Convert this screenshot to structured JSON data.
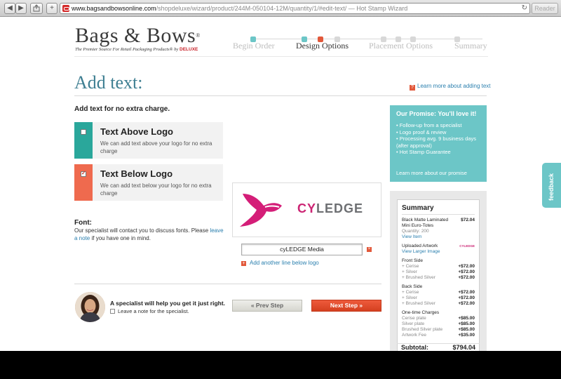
{
  "browser": {
    "url_host": "www.bagsandbowsonline.com",
    "url_path": "/shopdeluxe/wizard/product/244M-050104-12M/quantity/1/#edit-text/",
    "page_title": " — Hot Stamp Wizard",
    "reader_label": "Reader",
    "back_icon": "◀",
    "forward_icon": "▶",
    "add_icon": "+",
    "reload_icon": "↻"
  },
  "header": {
    "logo_name": "Bags & Bows",
    "logo_registered": "®",
    "logo_tagline": "The Premier Source For Retail Packaging Products®",
    "logo_by": "by",
    "logo_deluxe": "DELUXE",
    "steps": [
      {
        "label": "Begin Order"
      },
      {
        "label": "Design Options"
      },
      {
        "label": "Placement Options"
      },
      {
        "label": "Summary"
      }
    ]
  },
  "main": {
    "title": "Add text:",
    "learn_link": "Learn more about adding text",
    "help_glyph": "?",
    "subhead": "Add text for no extra charge.",
    "options": [
      {
        "title": "Text Above Logo",
        "desc": "We can add text above your logo for no extra charge",
        "checked": false,
        "color": "#2aa79b"
      },
      {
        "title": "Text Below Logo",
        "desc": "We can add text below your logo for no extra charge",
        "checked": true,
        "color": "#ef6a4e"
      }
    ],
    "font_title": "Font:",
    "font_text_1": "Our specialist will contact you to discuss fonts. Please",
    "font_link": "leave a note",
    "font_text_2": " if you have one in mind.",
    "preview_brand_1": "CY",
    "preview_brand_2": "LEDGE",
    "text_input_value": "cyLEDGE Media",
    "remove_glyph": "×",
    "add_line_plus": "+",
    "add_line": "Add another line below logo",
    "specialist_title": "A specialist will help you get it just right.",
    "leave_note": "Leave a note for the specialist.",
    "prev_button": "« Prev Step",
    "next_button": "Next Step »"
  },
  "promise": {
    "title": "Our Promise: You'll love it!",
    "items": [
      "Follow-up from a specialist",
      "Logo proof & review",
      "Processing avg. 9 business days (after approval)",
      "Hot Stamp Guarantee"
    ],
    "link": "Learn more about our promise"
  },
  "summary": {
    "title": "Summary",
    "product_name": "Black Matte Laminated Mini Euro-Totes",
    "product_price": "$72.04",
    "quantity": "Quantity: 200",
    "view_item": "View Item",
    "uploaded_artwork": "Uploaded Artwork",
    "view_larger": "View Larger Image",
    "mini_logo": "CYLEDGE",
    "front_side": "Front Side",
    "front_items": [
      {
        "name": "+ Cerise",
        "amt": "+$72.00"
      },
      {
        "name": "+ Silver",
        "amt": "+$72.00"
      },
      {
        "name": "+ Brushed Silver",
        "amt": "+$72.00"
      }
    ],
    "back_side": "Back Side",
    "back_items": [
      {
        "name": "+ Cerise",
        "amt": "+$72.00"
      },
      {
        "name": "+ Silver",
        "amt": "+$72.00"
      },
      {
        "name": "+ Brushed Silver",
        "amt": "+$72.00"
      }
    ],
    "one_time": "One-time Charges",
    "one_time_items": [
      {
        "name": "Cerise plate",
        "amt": "+$85.00"
      },
      {
        "name": "Silver plate",
        "amt": "+$85.00"
      },
      {
        "name": "Brushed Silver plate",
        "amt": "+$85.00"
      },
      {
        "name": "Artwork Fee",
        "amt": "+$35.00"
      }
    ],
    "subtotal_label": "Subtotal:",
    "subtotal_value": "$794.04"
  },
  "feedback": {
    "label": "feedback"
  },
  "colors": {
    "accent_teal": "#6cc6c7",
    "title_blue": "#3f7f92",
    "cta_red": "#e2583a",
    "link_blue": "#2a7fae"
  }
}
